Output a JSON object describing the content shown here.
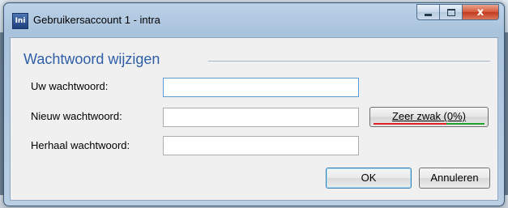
{
  "window": {
    "title": "Gebruikersaccount 1 - intra",
    "app_icon_text": "Ini"
  },
  "group": {
    "title": "Wachtwoord wijzigen"
  },
  "fields": {
    "current_label": "Uw wachtwoord:",
    "current_value": "",
    "new_label": "Nieuw wachtwoord:",
    "new_value": "",
    "repeat_label": "Herhaal wachtwoord:",
    "repeat_value": ""
  },
  "strength": {
    "label": "Zeer zwak (0%)",
    "percent": 0,
    "weak_color": "#e02020",
    "strong_color": "#1fa32a"
  },
  "buttons": {
    "ok": "OK",
    "cancel": "Annuleren"
  },
  "caption": {
    "minimize_icon": "minimize-icon",
    "maximize_icon": "maximize-icon",
    "close_glyph": "x"
  }
}
